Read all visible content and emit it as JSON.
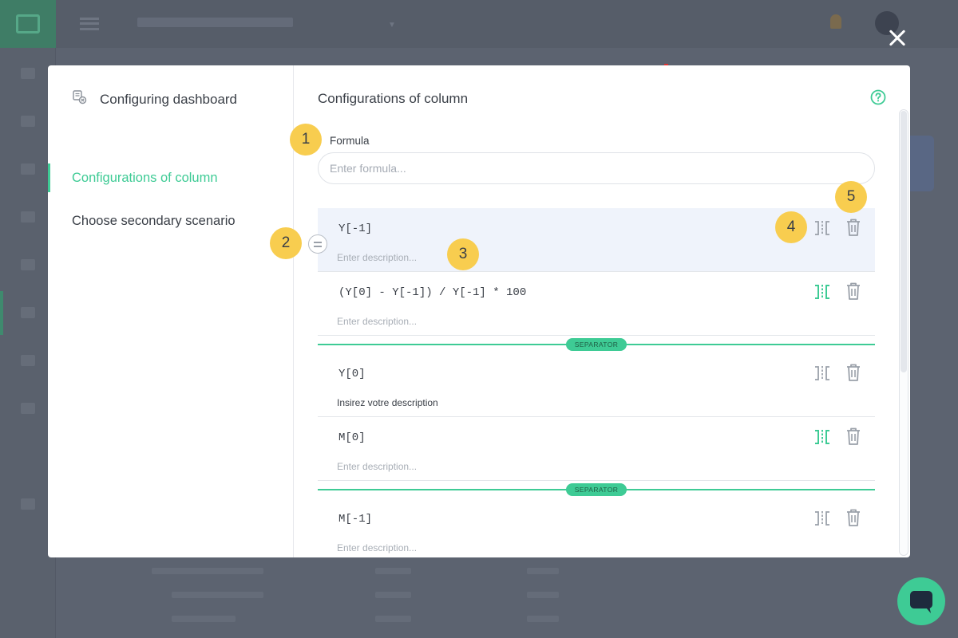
{
  "left_panel": {
    "title": "Configuring dashboard",
    "nav": [
      {
        "label": "Configurations of column",
        "active": true
      },
      {
        "label": "Choose secondary scenario",
        "active": false
      }
    ]
  },
  "right_panel": {
    "title": "Configurations of column",
    "formula": {
      "label": "Formula",
      "placeholder": "Enter formula..."
    },
    "rows": [
      {
        "formula": "Y[-1]",
        "description_placeholder": "Enter description...",
        "description": "",
        "separator_active": false
      },
      {
        "formula": "(Y[0] - Y[-1]) / Y[-1] * 100",
        "description_placeholder": "Enter description...",
        "description": "",
        "separator_active": true
      },
      {
        "formula": "Y[0]",
        "description_placeholder": "",
        "description": "Insirez votre description",
        "separator_active": false
      },
      {
        "formula": "M[0]",
        "description_placeholder": "Enter description...",
        "description": "",
        "separator_active": true
      },
      {
        "formula": "M[-1]",
        "description_placeholder": "Enter description...",
        "description": "",
        "separator_active": false
      }
    ],
    "separator_label": "SEPARATOR"
  },
  "markers": [
    "1",
    "2",
    "3",
    "4",
    "5"
  ],
  "colors": {
    "accent": "#3ecb95",
    "marker": "#f8cd4f",
    "text": "#3a3f47",
    "placeholder": "#a8aeb6",
    "icon_inactive": "#9aa0a9"
  },
  "icons": [
    "close-icon",
    "dashboard-config-icon",
    "help-icon",
    "drag-handle-icon",
    "separator-icon",
    "trash-icon",
    "chat-icon"
  ]
}
